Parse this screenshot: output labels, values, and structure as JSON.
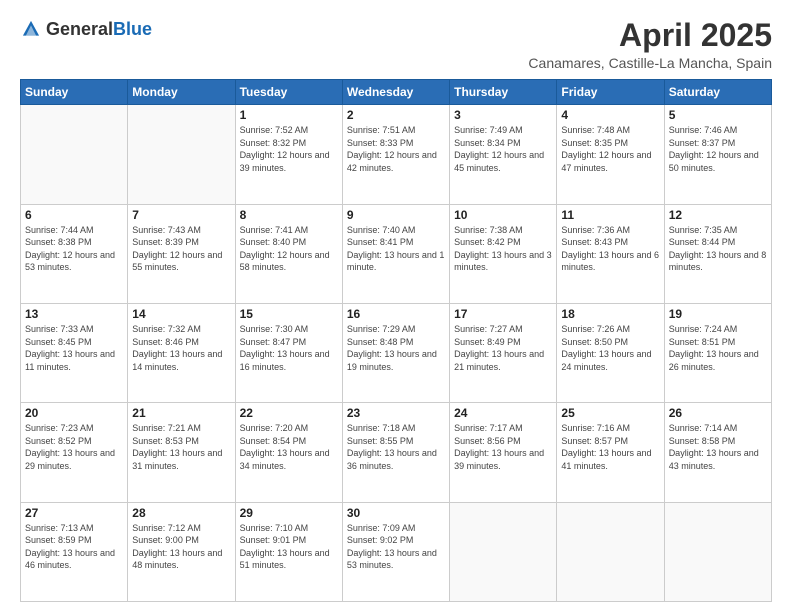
{
  "header": {
    "logo_general": "General",
    "logo_blue": "Blue",
    "title": "April 2025",
    "location": "Canamares, Castille-La Mancha, Spain"
  },
  "days_of_week": [
    "Sunday",
    "Monday",
    "Tuesday",
    "Wednesday",
    "Thursday",
    "Friday",
    "Saturday"
  ],
  "weeks": [
    [
      {
        "day": "",
        "sunrise": "",
        "sunset": "",
        "daylight": ""
      },
      {
        "day": "",
        "sunrise": "",
        "sunset": "",
        "daylight": ""
      },
      {
        "day": "1",
        "sunrise": "Sunrise: 7:52 AM",
        "sunset": "Sunset: 8:32 PM",
        "daylight": "Daylight: 12 hours and 39 minutes."
      },
      {
        "day": "2",
        "sunrise": "Sunrise: 7:51 AM",
        "sunset": "Sunset: 8:33 PM",
        "daylight": "Daylight: 12 hours and 42 minutes."
      },
      {
        "day": "3",
        "sunrise": "Sunrise: 7:49 AM",
        "sunset": "Sunset: 8:34 PM",
        "daylight": "Daylight: 12 hours and 45 minutes."
      },
      {
        "day": "4",
        "sunrise": "Sunrise: 7:48 AM",
        "sunset": "Sunset: 8:35 PM",
        "daylight": "Daylight: 12 hours and 47 minutes."
      },
      {
        "day": "5",
        "sunrise": "Sunrise: 7:46 AM",
        "sunset": "Sunset: 8:37 PM",
        "daylight": "Daylight: 12 hours and 50 minutes."
      }
    ],
    [
      {
        "day": "6",
        "sunrise": "Sunrise: 7:44 AM",
        "sunset": "Sunset: 8:38 PM",
        "daylight": "Daylight: 12 hours and 53 minutes."
      },
      {
        "day": "7",
        "sunrise": "Sunrise: 7:43 AM",
        "sunset": "Sunset: 8:39 PM",
        "daylight": "Daylight: 12 hours and 55 minutes."
      },
      {
        "day": "8",
        "sunrise": "Sunrise: 7:41 AM",
        "sunset": "Sunset: 8:40 PM",
        "daylight": "Daylight: 12 hours and 58 minutes."
      },
      {
        "day": "9",
        "sunrise": "Sunrise: 7:40 AM",
        "sunset": "Sunset: 8:41 PM",
        "daylight": "Daylight: 13 hours and 1 minute."
      },
      {
        "day": "10",
        "sunrise": "Sunrise: 7:38 AM",
        "sunset": "Sunset: 8:42 PM",
        "daylight": "Daylight: 13 hours and 3 minutes."
      },
      {
        "day": "11",
        "sunrise": "Sunrise: 7:36 AM",
        "sunset": "Sunset: 8:43 PM",
        "daylight": "Daylight: 13 hours and 6 minutes."
      },
      {
        "day": "12",
        "sunrise": "Sunrise: 7:35 AM",
        "sunset": "Sunset: 8:44 PM",
        "daylight": "Daylight: 13 hours and 8 minutes."
      }
    ],
    [
      {
        "day": "13",
        "sunrise": "Sunrise: 7:33 AM",
        "sunset": "Sunset: 8:45 PM",
        "daylight": "Daylight: 13 hours and 11 minutes."
      },
      {
        "day": "14",
        "sunrise": "Sunrise: 7:32 AM",
        "sunset": "Sunset: 8:46 PM",
        "daylight": "Daylight: 13 hours and 14 minutes."
      },
      {
        "day": "15",
        "sunrise": "Sunrise: 7:30 AM",
        "sunset": "Sunset: 8:47 PM",
        "daylight": "Daylight: 13 hours and 16 minutes."
      },
      {
        "day": "16",
        "sunrise": "Sunrise: 7:29 AM",
        "sunset": "Sunset: 8:48 PM",
        "daylight": "Daylight: 13 hours and 19 minutes."
      },
      {
        "day": "17",
        "sunrise": "Sunrise: 7:27 AM",
        "sunset": "Sunset: 8:49 PM",
        "daylight": "Daylight: 13 hours and 21 minutes."
      },
      {
        "day": "18",
        "sunrise": "Sunrise: 7:26 AM",
        "sunset": "Sunset: 8:50 PM",
        "daylight": "Daylight: 13 hours and 24 minutes."
      },
      {
        "day": "19",
        "sunrise": "Sunrise: 7:24 AM",
        "sunset": "Sunset: 8:51 PM",
        "daylight": "Daylight: 13 hours and 26 minutes."
      }
    ],
    [
      {
        "day": "20",
        "sunrise": "Sunrise: 7:23 AM",
        "sunset": "Sunset: 8:52 PM",
        "daylight": "Daylight: 13 hours and 29 minutes."
      },
      {
        "day": "21",
        "sunrise": "Sunrise: 7:21 AM",
        "sunset": "Sunset: 8:53 PM",
        "daylight": "Daylight: 13 hours and 31 minutes."
      },
      {
        "day": "22",
        "sunrise": "Sunrise: 7:20 AM",
        "sunset": "Sunset: 8:54 PM",
        "daylight": "Daylight: 13 hours and 34 minutes."
      },
      {
        "day": "23",
        "sunrise": "Sunrise: 7:18 AM",
        "sunset": "Sunset: 8:55 PM",
        "daylight": "Daylight: 13 hours and 36 minutes."
      },
      {
        "day": "24",
        "sunrise": "Sunrise: 7:17 AM",
        "sunset": "Sunset: 8:56 PM",
        "daylight": "Daylight: 13 hours and 39 minutes."
      },
      {
        "day": "25",
        "sunrise": "Sunrise: 7:16 AM",
        "sunset": "Sunset: 8:57 PM",
        "daylight": "Daylight: 13 hours and 41 minutes."
      },
      {
        "day": "26",
        "sunrise": "Sunrise: 7:14 AM",
        "sunset": "Sunset: 8:58 PM",
        "daylight": "Daylight: 13 hours and 43 minutes."
      }
    ],
    [
      {
        "day": "27",
        "sunrise": "Sunrise: 7:13 AM",
        "sunset": "Sunset: 8:59 PM",
        "daylight": "Daylight: 13 hours and 46 minutes."
      },
      {
        "day": "28",
        "sunrise": "Sunrise: 7:12 AM",
        "sunset": "Sunset: 9:00 PM",
        "daylight": "Daylight: 13 hours and 48 minutes."
      },
      {
        "day": "29",
        "sunrise": "Sunrise: 7:10 AM",
        "sunset": "Sunset: 9:01 PM",
        "daylight": "Daylight: 13 hours and 51 minutes."
      },
      {
        "day": "30",
        "sunrise": "Sunrise: 7:09 AM",
        "sunset": "Sunset: 9:02 PM",
        "daylight": "Daylight: 13 hours and 53 minutes."
      },
      {
        "day": "",
        "sunrise": "",
        "sunset": "",
        "daylight": ""
      },
      {
        "day": "",
        "sunrise": "",
        "sunset": "",
        "daylight": ""
      },
      {
        "day": "",
        "sunrise": "",
        "sunset": "",
        "daylight": ""
      }
    ]
  ]
}
